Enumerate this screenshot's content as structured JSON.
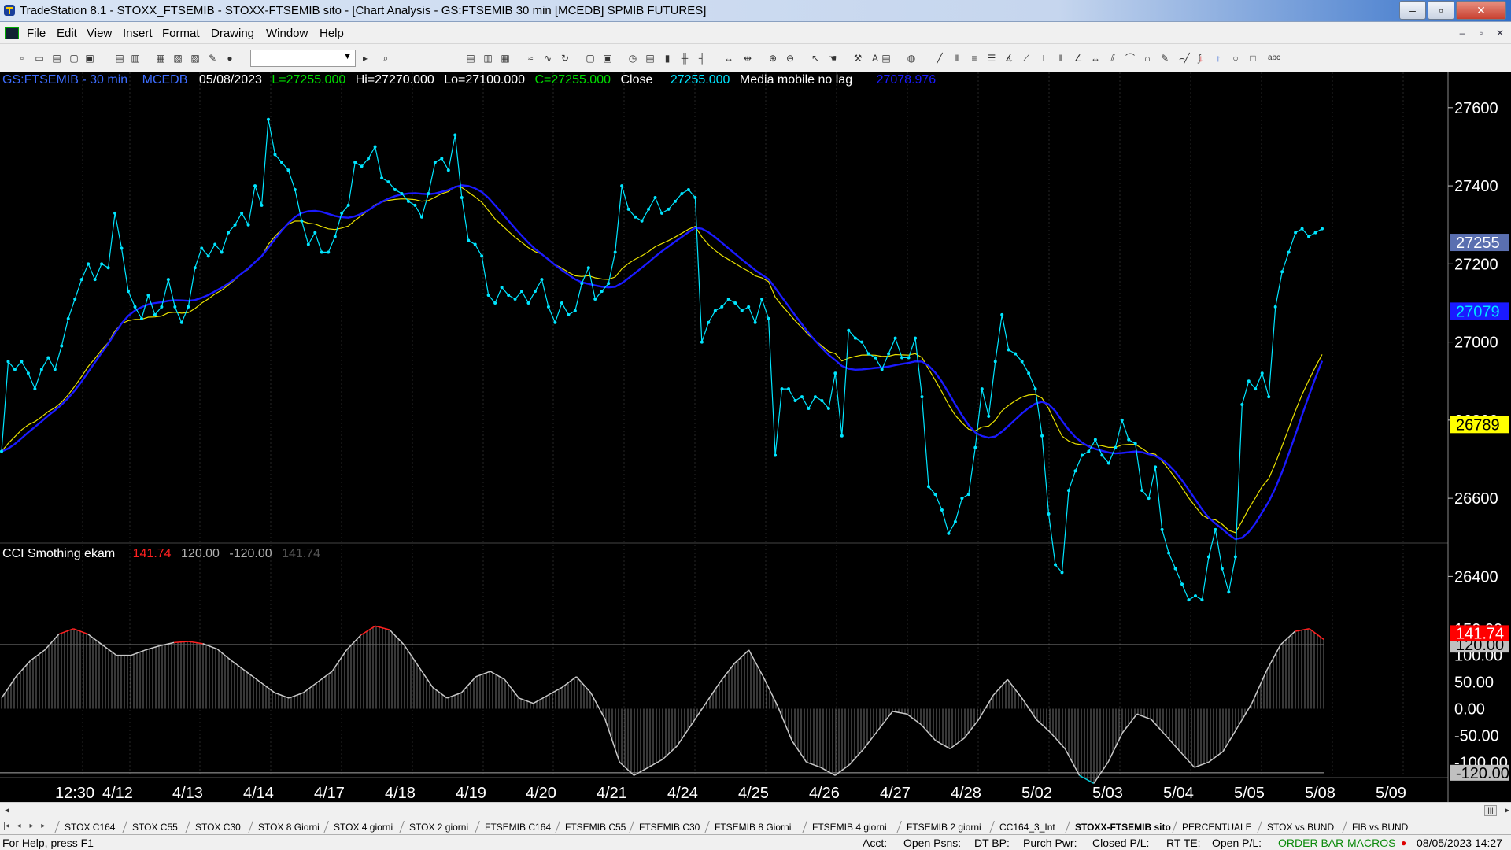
{
  "window": {
    "title": "TradeStation 8.1 - STOXX_FTSEMIB - STOXX-FTSEMIB sito - [Chart Analysis - GS:FTSEMIB  30 min  [MCEDB] SPMIB FUTURES]",
    "minimize": "–",
    "maximize": "▫",
    "close": "✕"
  },
  "menu": [
    "File",
    "Edit",
    "View",
    "Insert",
    "Format",
    "Drawing",
    "Window",
    "Help"
  ],
  "mdi_controls": [
    "–",
    "▫",
    "✕"
  ],
  "toolbar": {
    "symbol_value": ""
  },
  "price_header": {
    "symbol": "GS:FTSEMIB - 30 min",
    "exchange": "MCEDB",
    "date": "05/08/2023",
    "last": "L=27255.000",
    "high": "Hi=27270.000",
    "low": "Lo=27100.000",
    "close": "C=27255.000",
    "close_label": "Close",
    "close_value": "27255.000",
    "ma_label": "Media mobile no lag",
    "ma_value": "27078.976"
  },
  "cci_header": {
    "name": "CCI Smothing ekam",
    "value": "141.74",
    "upper": "120.00",
    "lower": "-120.00",
    "value2": "141.74"
  },
  "price_axis": [
    "27600",
    "27400",
    "27200",
    "27000",
    "26800",
    "26600",
    "26400"
  ],
  "price_markers": {
    "last": "27255",
    "blue_ma": "27079",
    "yellow_ma": "26789"
  },
  "cci_axis": [
    "150.00",
    "100.00",
    "50.00",
    "0.00",
    "-50.00",
    "-100.00",
    "-120.00"
  ],
  "cci_markers": {
    "value": "141.74",
    "upper": "120.00",
    "lower": "-120.00"
  },
  "date_axis": [
    "12:30",
    "4/12",
    "4/13",
    "4/14",
    "4/17",
    "4/18",
    "4/19",
    "4/20",
    "4/21",
    "4/24",
    "4/25",
    "4/26",
    "4/27",
    "4/28",
    "5/02",
    "5/03",
    "5/04",
    "5/05",
    "5/08",
    "5/09"
  ],
  "tabs": [
    "STOX C164",
    "STOX C55",
    "STOX  C30",
    "STOX  8 Giorni",
    "STOX 4 giorni",
    "STOX  2 giorni",
    "FTSEMIB C164",
    "FTSEMIB C55",
    "FTSEMIB C30",
    "FTSEMIB  8 Giorni",
    "FTSEMIB  4 giorni",
    "FTSEMIB  2 giorni",
    "CC164_3_Int",
    "STOXX-FTSEMIB sito",
    "PERCENTUALE",
    "STOX vs BUND",
    "FIB vs BUND"
  ],
  "active_tab": "STOXX-FTSEMIB sito",
  "status": {
    "help": "For Help, press F1",
    "acct": "Acct:",
    "open_psns": "Open Psns:",
    "dt_bp": "DT BP:",
    "purch_pwr": "Purch Pwr:",
    "closed_pl": "Closed P/L:",
    "rt_te": "RT TE:",
    "open_pl": "Open P/L:",
    "order_bar": "ORDER BAR",
    "macros": "MACROS",
    "datetime": "08/05/2023 14:27"
  },
  "colors": {
    "price": "#00e5ff",
    "blue_ma": "#1a1aff",
    "yellow_ma": "#e8e000",
    "cci_line": "#c8c8c8",
    "cci_over": "#ff2020",
    "cci_under": "#00d0e0",
    "header_symbol": "#3d6dff",
    "header_green": "#00dd00"
  },
  "chart_data": {
    "type": "line",
    "price_range": [
      26300,
      27650
    ],
    "cci_range": [
      -135,
      160
    ],
    "close": [
      26720,
      26950,
      26930,
      26950,
      26920,
      26880,
      26930,
      26960,
      26930,
      26990,
      27060,
      27110,
      27160,
      27200,
      27160,
      27200,
      27190,
      27330,
      27240,
      27130,
      27090,
      27060,
      27120,
      27070,
      27090,
      27160,
      27090,
      27050,
      27090,
      27190,
      27240,
      27220,
      27250,
      27230,
      27280,
      27300,
      27330,
      27300,
      27400,
      27350,
      27570,
      27480,
      27460,
      27440,
      27390,
      27310,
      27250,
      27280,
      27230,
      27230,
      27270,
      27330,
      27350,
      27460,
      27450,
      27470,
      27500,
      27420,
      27410,
      27390,
      27380,
      27360,
      27350,
      27320,
      27380,
      27460,
      27470,
      27440,
      27530,
      27370,
      27260,
      27250,
      27220,
      27120,
      27100,
      27140,
      27120,
      27110,
      27130,
      27100,
      27130,
      27160,
      27090,
      27050,
      27100,
      27070,
      27080,
      27150,
      27190,
      27110,
      27130,
      27150,
      27230,
      27400,
      27340,
      27320,
      27310,
      27340,
      27370,
      27330,
      27340,
      27360,
      27380,
      27390,
      27370,
      27000,
      27050,
      27080,
      27090,
      27110,
      27100,
      27080,
      27090,
      27050,
      27110,
      27060,
      26710,
      26880,
      26880,
      26850,
      26860,
      26830,
      26860,
      26850,
      26830,
      26920,
      26760,
      27030,
      27010,
      27000,
      26970,
      26960,
      26930,
      26970,
      27010,
      26960,
      26960,
      27010,
      26860,
      26630,
      26610,
      26570,
      26510,
      26540,
      26600,
      26610,
      26730,
      26880,
      26810,
      26950,
      27070,
      26980,
      26970,
      26950,
      26920,
      26880,
      26760,
      26560,
      26430,
      26410,
      26620,
      26670,
      26710,
      26720,
      26750,
      26710,
      26690,
      26730,
      26800,
      26750,
      26740,
      26620,
      26600,
      26680,
      26520,
      26460,
      26420,
      26380,
      26340,
      26350,
      26340,
      26450,
      26520,
      26420,
      26360,
      26450,
      26840,
      26900,
      26880,
      26920,
      26860,
      27090,
      27180,
      27230,
      27280,
      27290,
      27270,
      27280,
      27290
    ],
    "cci": [
      20,
      60,
      90,
      110,
      140,
      150,
      140,
      120,
      100,
      100,
      110,
      118,
      124,
      126,
      122,
      112,
      90,
      70,
      50,
      30,
      20,
      30,
      50,
      70,
      110,
      138,
      155,
      148,
      120,
      80,
      40,
      20,
      30,
      60,
      70,
      55,
      20,
      10,
      25,
      40,
      60,
      30,
      -20,
      -100,
      -125,
      -110,
      -95,
      -70,
      -30,
      10,
      50,
      85,
      110,
      60,
      5,
      -60,
      -100,
      -110,
      -125,
      -105,
      -75,
      -40,
      -5,
      -10,
      -30,
      -60,
      -75,
      -55,
      -20,
      25,
      55,
      20,
      -20,
      -45,
      -75,
      -125,
      -140,
      -100,
      -45,
      -10,
      -20,
      -50,
      -80,
      -110,
      -100,
      -80,
      -35,
      10,
      70,
      120,
      145,
      150,
      130
    ],
    "title": "GS:FTSEMIB - 30 min"
  }
}
